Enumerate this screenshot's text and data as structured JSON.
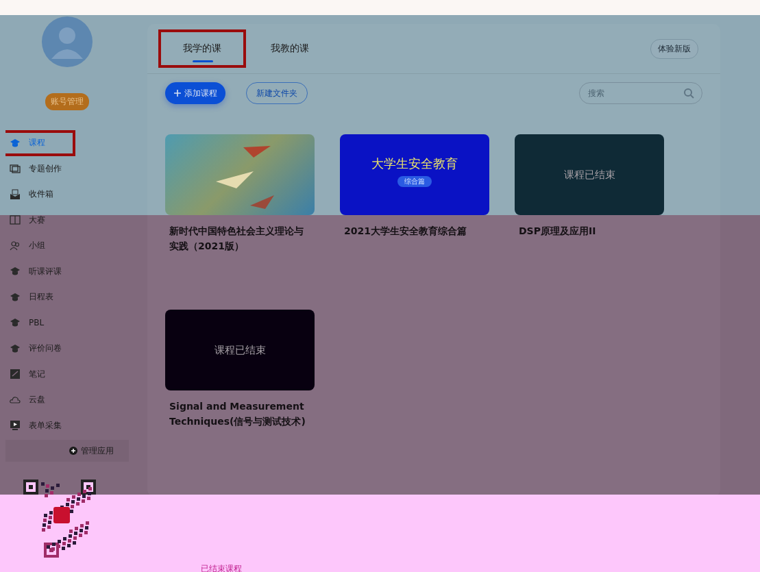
{
  "sidebar": {
    "account_button": "账号管理",
    "items": [
      {
        "label": "课程",
        "kind": "cap",
        "selected": true,
        "annotated": true
      },
      {
        "label": "专题创作",
        "kind": "windows",
        "selected": false,
        "annotated": false
      },
      {
        "label": "收件箱",
        "kind": "inbox",
        "selected": false,
        "annotated": false
      },
      {
        "label": "大赛",
        "kind": "book",
        "selected": false,
        "annotated": false
      },
      {
        "label": "小组",
        "kind": "group",
        "selected": false,
        "annotated": false
      },
      {
        "label": "听课评课",
        "kind": "cap",
        "selected": false,
        "annotated": false
      },
      {
        "label": "日程表",
        "kind": "cap",
        "selected": false,
        "annotated": false
      },
      {
        "label": "PBL",
        "kind": "cap",
        "selected": false,
        "annotated": false
      },
      {
        "label": "评价问卷",
        "kind": "cap",
        "selected": false,
        "annotated": false
      },
      {
        "label": "笔记",
        "kind": "note",
        "selected": false,
        "annotated": false
      },
      {
        "label": "云盘",
        "kind": "cloud",
        "selected": false,
        "annotated": false
      },
      {
        "label": "表单采集",
        "kind": "screen",
        "selected": false,
        "annotated": false
      }
    ],
    "manage_apps": "管理应用"
  },
  "tabs": [
    {
      "label": "我学的课",
      "selected": true,
      "annotated": true
    },
    {
      "label": "我教的课",
      "selected": false,
      "annotated": false
    }
  ],
  "new_version_button": "体验新版",
  "toolbar": {
    "add_course": "添加课程",
    "new_folder": "新建文件夹",
    "search": {
      "placeholder": "搜索"
    }
  },
  "courses": [
    {
      "kind": "image",
      "title": "新时代中国特色社会主义理论与实践（2021版）"
    },
    {
      "kind": "poster",
      "poster_title": "大学生安全教育",
      "poster_subtitle": "综合篇",
      "title": "2021大学生安全教育综合篇"
    },
    {
      "kind": "ended",
      "overlay": "课程已结束",
      "title": "DSP原理及应用II"
    },
    {
      "kind": "ended",
      "overlay": "课程已结束",
      "title": "Signal and Measurement Techniques(信号与测试技术)"
    }
  ],
  "ended_courses_link": "已结束课程"
}
